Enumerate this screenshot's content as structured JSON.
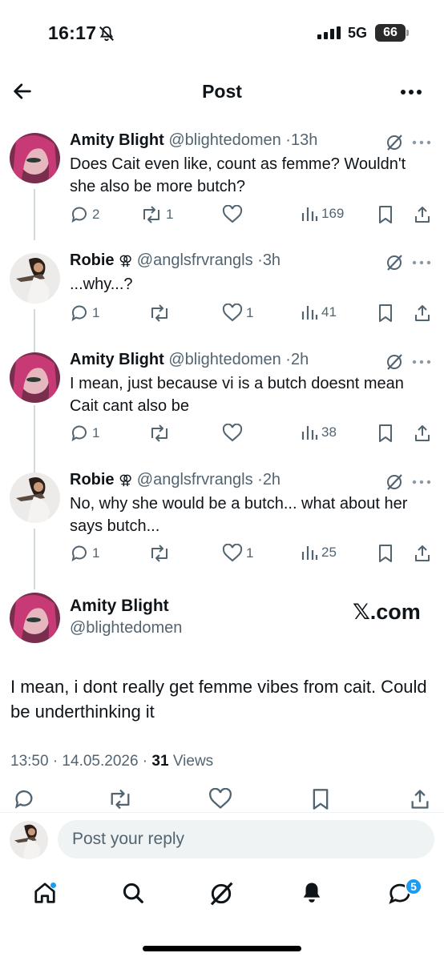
{
  "status_bar": {
    "time": "16:17",
    "network": "5G",
    "battery": "66"
  },
  "header": {
    "title": "Post"
  },
  "replies": [
    {
      "name": "Amity Blight",
      "handle": "@blightedomen",
      "time": "13h",
      "text": "Does Cait even like, count as femme? Wouldn't she also be more butch?",
      "replies": "2",
      "reposts": "1",
      "likes": "",
      "views": "169"
    },
    {
      "name": "Robie",
      "name_symbol": "⚢",
      "handle": "@anglsfrvrangls",
      "time": "3h",
      "text": "...why...?",
      "replies": "1",
      "reposts": "",
      "likes": "1",
      "views": "41"
    },
    {
      "name": "Amity Blight",
      "handle": "@blightedomen",
      "time": "2h",
      "text": "I mean, just because vi is a butch doesnt mean Cait cant also be",
      "replies": "1",
      "reposts": "",
      "likes": "",
      "views": "38"
    },
    {
      "name": "Robie",
      "name_symbol": "⚢",
      "handle": "@anglsfrvrangls",
      "time": "2h",
      "text": "No, why she would be a butch... what about her says butch...",
      "replies": "1",
      "reposts": "",
      "likes": "1",
      "views": "25"
    }
  ],
  "main_post": {
    "name": "Amity Blight",
    "handle": "@blightedomen",
    "watermark": "𝕏.com",
    "text": "I mean, i dont really get femme vibes from cait. Could be underthinking it",
    "timestamp": "13:50 · 14.05.2026 · ",
    "views_count": "31",
    "views_label": " Views"
  },
  "reply_bar": {
    "placeholder": "Post your reply"
  },
  "nav": {
    "messages_badge": "5"
  },
  "colors": {
    "text": "#0f1419",
    "secondary": "#536471",
    "accent": "#1d9bf0",
    "line": "#cfd9de"
  }
}
